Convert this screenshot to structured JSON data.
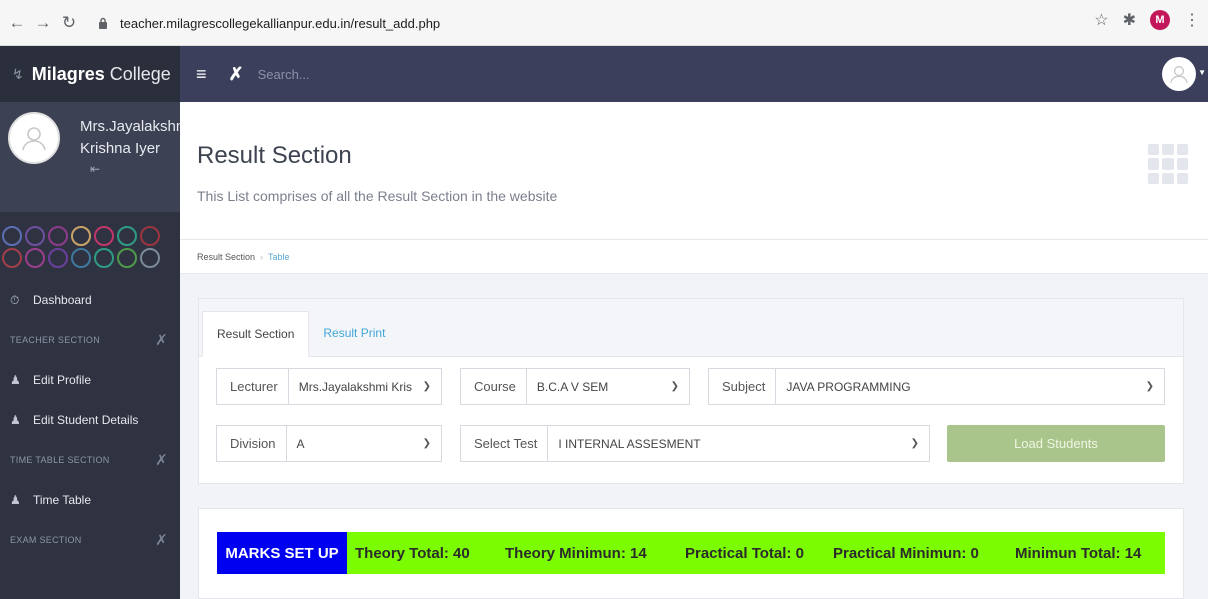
{
  "browser": {
    "url": "teacher.milagrescollegekallianpur.edu.in/result_add.php",
    "profile_initial": "M"
  },
  "brand": {
    "strong": "Milagres",
    "light": "College"
  },
  "profile": {
    "name_line1": "Mrs.Jayalakshmi",
    "name_line2": "Krishna Iyer"
  },
  "swatches": {
    "row1": [
      "#5b6fb3",
      "#6e4fa0",
      "#8e3b8a",
      "#c9a36a",
      "#c2366b",
      "#2f9c83",
      "#9c3540"
    ],
    "row2": [
      "#a33e4b",
      "#9a3f8e",
      "#6b3f9e",
      "#3f7a9e",
      "#2f9c83",
      "#4e9a4a",
      "#7a8a96"
    ]
  },
  "sidebar": {
    "dashboard": "Dashboard",
    "teacher_section": "TEACHER SECTION",
    "edit_profile": "Edit Profile",
    "edit_student_details": "Edit Student Details",
    "time_table_section": "TIME TABLE SECTION",
    "time_table": "Time Table",
    "exam_section": "EXAM SECTION"
  },
  "topbar": {
    "search_placeholder": "Search..."
  },
  "page": {
    "title": "Result Section",
    "subtitle": "This List comprises of all the Result Section in the website"
  },
  "breadcrumb": {
    "root": "Result Section",
    "current": "Table"
  },
  "tabs": {
    "result_section": "Result Section",
    "result_print": "Result Print"
  },
  "form": {
    "lecturer_label": "Lecturer",
    "lecturer_value": "Mrs.Jayalakshmi Kris",
    "course_label": "Course",
    "course_value": "B.C.A V SEM",
    "subject_label": "Subject",
    "subject_value": "JAVA PROGRAMMING",
    "division_label": "Division",
    "division_value": "A",
    "test_label": "Select Test",
    "test_value": "I INTERNAL ASSESMENT",
    "load_button": "Load Students"
  },
  "marks": {
    "title": "MARKS SET UP",
    "theory_total": "Theory Total: 40",
    "theory_minimum": "Theory Minimun: 14",
    "practical_total": "Practical Total: 0",
    "practical_minimum": "Practical Minimun: 0",
    "minimum_total": "Minimun Total: 14"
  }
}
